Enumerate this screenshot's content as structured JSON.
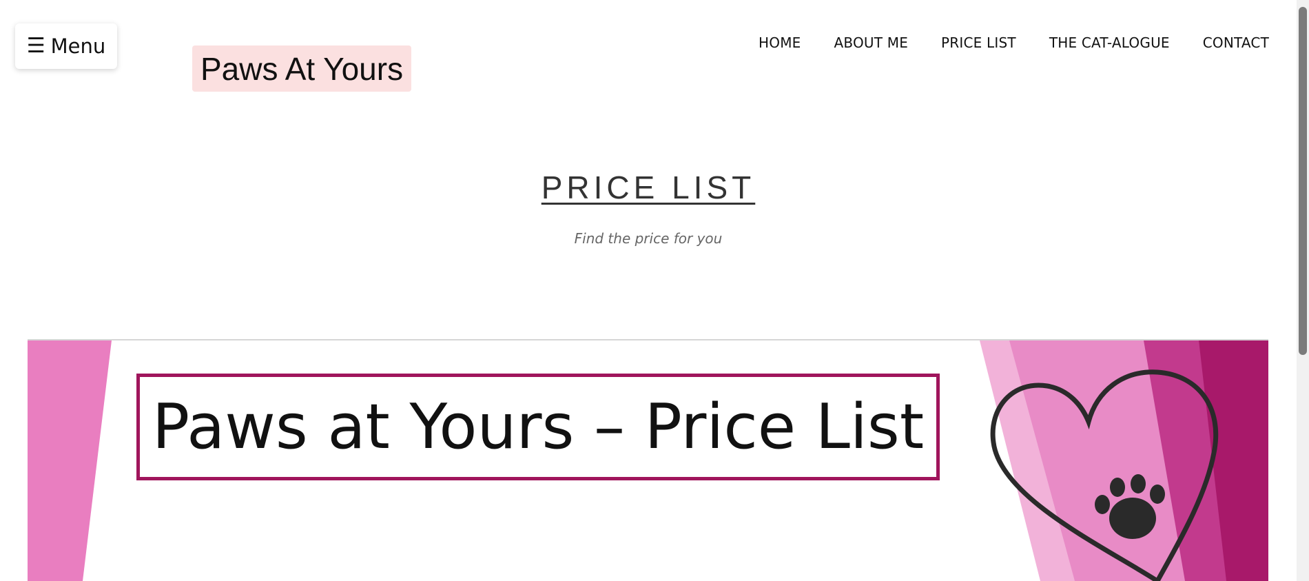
{
  "header": {
    "menu_label": "Menu",
    "menu_icon": "☰",
    "logo_text": "Paws At Yours",
    "nav": [
      "HOME",
      "ABOUT ME",
      "PRICE LIST",
      "THE CAT-ALOGUE",
      "CONTACT"
    ]
  },
  "main": {
    "title": "PRICE LIST",
    "subtitle": "Find the price for you",
    "banner_text": "Paws at Yours – Price List"
  },
  "colors": {
    "logo_bg": "#fbe0e0",
    "banner_pink_light": "#e98bc4",
    "banner_magenta": "#a8196a",
    "banner_border": "#a0155c"
  },
  "icons": [
    "hamburger-icon",
    "heart-icon",
    "paw-print-icon"
  ]
}
